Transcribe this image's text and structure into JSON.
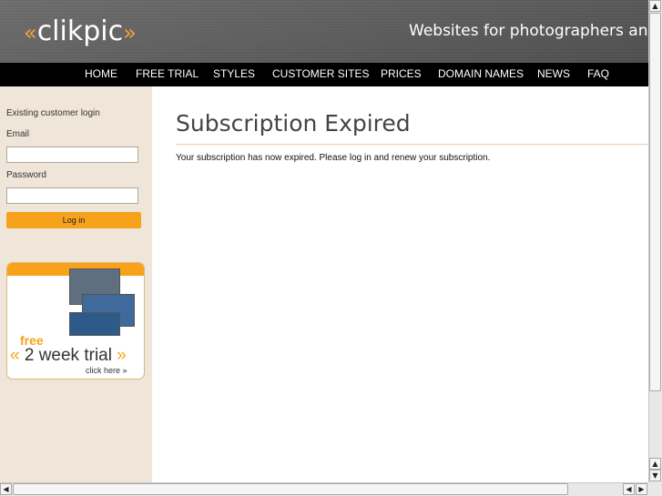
{
  "header": {
    "logo_open": "«",
    "logo_text": "clikpic",
    "logo_close": "»",
    "tagline": "Websites for photographers and"
  },
  "nav": {
    "items": [
      "HOME",
      "FREE TRIAL",
      "STYLES",
      "CUSTOMER SITES",
      "PRICES",
      "DOMAIN NAMES",
      "NEWS",
      "FAQ"
    ]
  },
  "sidebar": {
    "login_heading": "Existing customer login",
    "email_label": "Email",
    "email_value": "",
    "password_label": "Password",
    "password_value": "",
    "login_button": "Log in",
    "promo": {
      "free": "free",
      "open_quote": "«",
      "trial": " 2 week trial ",
      "close_quote": "»",
      "click": "click here »"
    }
  },
  "main": {
    "title": "Subscription Expired",
    "message": "Your subscription has now expired. Please log in and renew your subscription."
  },
  "colors": {
    "accent": "#f7a21b",
    "nav_bg": "#000000",
    "sidebar_bg": "#efe5d8",
    "rule": "#f0c9a6"
  }
}
